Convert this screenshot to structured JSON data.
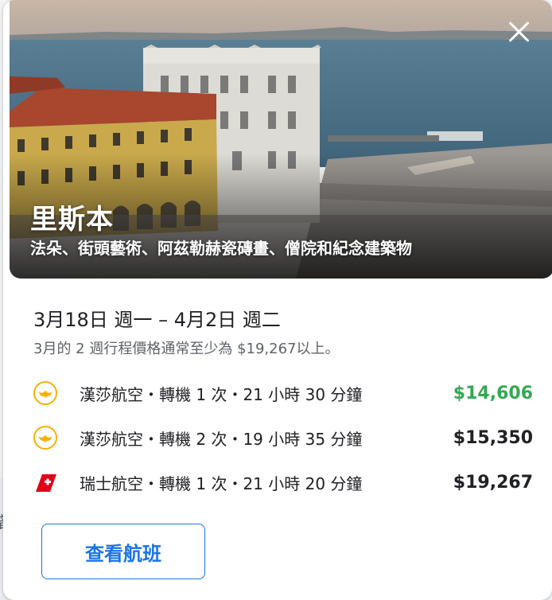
{
  "destination": {
    "name": "里斯本",
    "tagline": "法朵、街頭藝術、阿茲勒赫瓷磚畫、僧院和紀念建築物"
  },
  "trip": {
    "dates": "3月18日 週一 – 4月2日 週二",
    "price_note": "3月的 2 週行程價格通常至少為 $19,267以上。"
  },
  "flights": [
    {
      "airline_icon": "lufthansa-logo-icon",
      "description": "漢莎航空・轉機 1 次・21 小時 30 分鐘",
      "price": "$14,606",
      "price_color": "#34a853"
    },
    {
      "airline_icon": "lufthansa-logo-icon",
      "description": "漢莎航空・轉機 2 次・19 小時 35 分鐘",
      "price": "$15,350",
      "price_color": "#202124"
    },
    {
      "airline_icon": "swiss-logo-icon",
      "description": "瑞士航空・轉機 1 次・21 小時 20 分鐘",
      "price": "$19,267",
      "price_color": "#202124"
    }
  ],
  "actions": {
    "view_flights": "查看航班"
  },
  "background": {
    "fragment": "曾"
  },
  "colors": {
    "accent": "#1a73e8",
    "best_price": "#34a853",
    "lufthansa": "#f9b000",
    "swiss": "#e2001a"
  }
}
